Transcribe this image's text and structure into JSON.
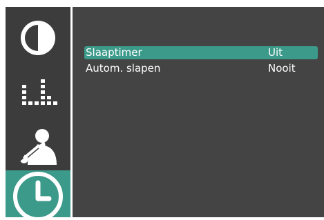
{
  "sidebar": {
    "items": [
      {
        "icon": "picture-contrast-icon",
        "active": false
      },
      {
        "icon": "sound-equalizer-icon",
        "active": false
      },
      {
        "icon": "setup-tools-person-icon",
        "active": false
      },
      {
        "icon": "clock-timer-icon",
        "active": true
      }
    ]
  },
  "menu": {
    "rows": [
      {
        "label": "Slaaptimer",
        "value": "Uit",
        "selected": true
      },
      {
        "label": "Autom. slapen",
        "value": "Nooit",
        "selected": false
      }
    ]
  },
  "colors": {
    "background": "#3c3c3c",
    "panel": "#444444",
    "accent": "#3c9a8a",
    "text": "#ffffff"
  }
}
